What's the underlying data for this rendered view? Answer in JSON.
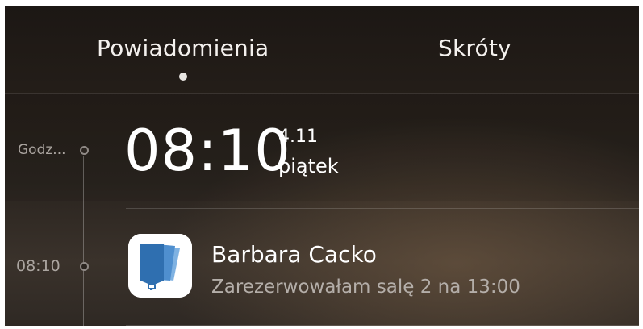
{
  "tabs": [
    {
      "label": "Powiadomienia",
      "active": true
    },
    {
      "label": "Skróty",
      "active": false
    }
  ],
  "timeline": [
    {
      "label": "Godz..."
    },
    {
      "label": "08:10"
    }
  ],
  "clock": {
    "time": "08:10",
    "date": "4.11",
    "weekday": "piątek"
  },
  "notification": {
    "app_icon": "blue-cards-app-icon",
    "title": "Barbara Cacko",
    "body": "Zarezerwowałam salę 2 na 13:00"
  },
  "colors": {
    "icon_blue": "#2f6fb0",
    "icon_blue_light": "#5a9ad6"
  }
}
